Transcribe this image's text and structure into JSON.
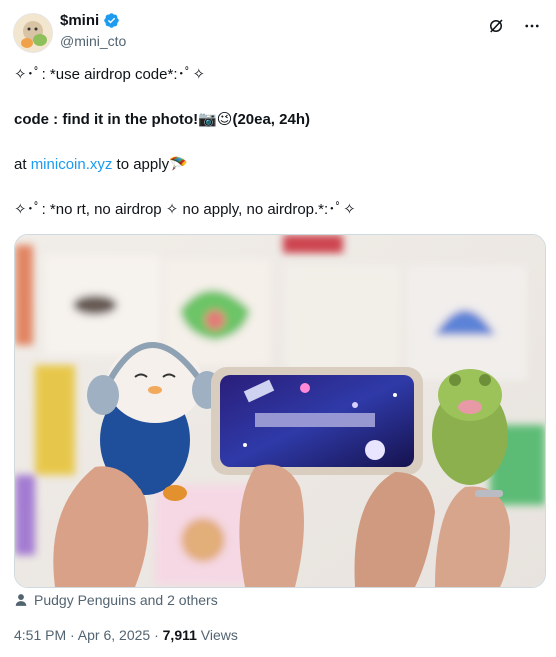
{
  "user": {
    "display_name": "$mini",
    "handle": "@mini_cto"
  },
  "icons": {
    "verified": "verified-badge-icon",
    "grok": "grok-icon",
    "more": "more-icon",
    "person": "person-icon"
  },
  "tweet": {
    "line1": "✧･ﾟ: *use airdrop code*:･ﾟ✧",
    "line2": "code : find it in the photo!📷😉(20ea, 24h)",
    "line3_prefix": "at ",
    "line3_link": "minicoin.xyz",
    "line3_suffix": " to apply🪂",
    "line4": "✧･ﾟ: *no rt, no airdrop ✧ no apply, no airdrop.*:･ﾟ✧"
  },
  "photo": {
    "alt": "Hands holding plush toys and a phone with a blurred code on screen"
  },
  "tagged_text": "Pudgy Penguins and 2 others",
  "meta": {
    "time_date": "4:51 PM · Apr 6, 2025 · ",
    "views_count": "7,911",
    "views_label": " Views"
  },
  "colors": {
    "link": "#1d9bf0",
    "verified": "#1d9bf0",
    "secondary_text": "#536471"
  }
}
